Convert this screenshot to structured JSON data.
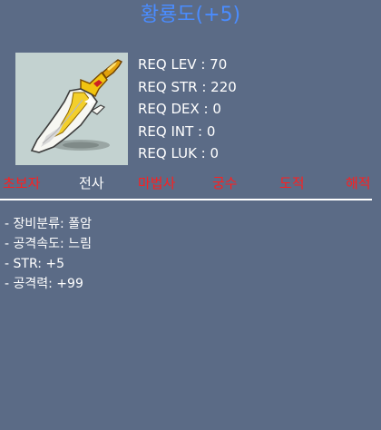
{
  "item": {
    "title": "황룡도(+5)",
    "icon": "golden-dragon-blade-icon"
  },
  "requirements": [
    "REQ LEV : 70",
    "REQ STR : 220",
    "REQ DEX : 0",
    "REQ INT : 0",
    "REQ LUK : 0"
  ],
  "jobs": [
    {
      "label": "초보자",
      "color": "#ff1e1e"
    },
    {
      "label": "전사",
      "color": "#ffffff"
    },
    {
      "label": "마법사",
      "color": "#ff1e1e"
    },
    {
      "label": "궁수",
      "color": "#ff1e1e"
    },
    {
      "label": "도적",
      "color": "#ff1e1e"
    },
    {
      "label": "해적",
      "color": "#ff1e1e"
    }
  ],
  "stats": [
    "- 장비분류: 폴암",
    "- 공격속도: 느림",
    "- STR: +5",
    "- 공격력: +99"
  ],
  "colors": {
    "background": "#5b6b86",
    "title": "#4a8cff",
    "unavailable_job": "#ff1e1e",
    "available_job": "#ffffff"
  }
}
